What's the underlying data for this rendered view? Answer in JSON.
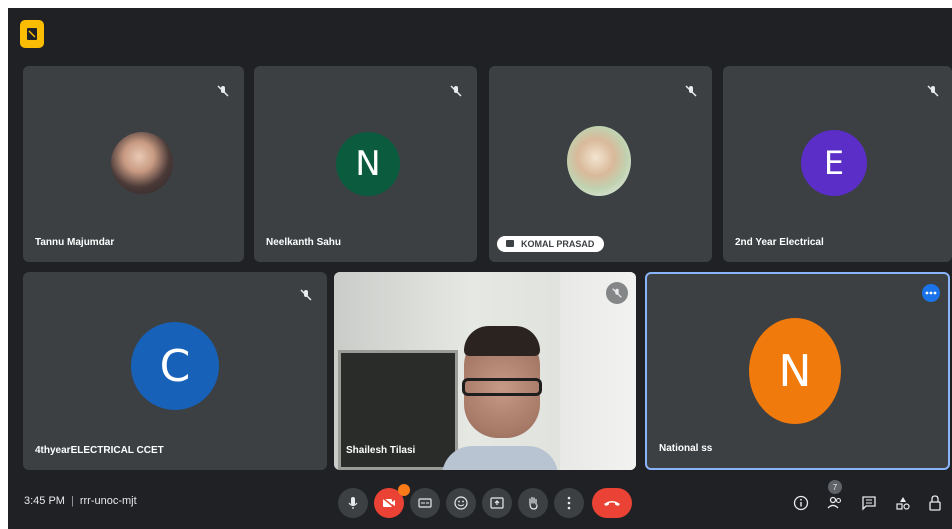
{
  "meeting": {
    "time": "3:45 PM",
    "separator": "|",
    "code": "rrr-unoc-mjt"
  },
  "participants": [
    {
      "name": "Tannu Majumdar",
      "avatar_type": "photo",
      "muted": true
    },
    {
      "name": "Neelkanth Sahu",
      "initial": "N",
      "avatar_color": "#0b5c3e",
      "muted": true
    },
    {
      "name": "KOMAL PRASAD",
      "avatar_type": "photo",
      "muted": true,
      "presenting_chip": true
    },
    {
      "name": "2nd Year Electrical",
      "initial": "E",
      "avatar_color": "#5b2ec7",
      "muted": true
    },
    {
      "name": "4thyearELECTRICAL CCET",
      "initial": "C",
      "avatar_color": "#1762b8",
      "muted": true
    },
    {
      "name": "Shailesh Tilasi",
      "avatar_type": "video",
      "muted": true
    },
    {
      "name": "National ss",
      "initial": "N",
      "avatar_color": "#f07a0c",
      "muted": false,
      "active_speaker": true
    }
  ],
  "people_count": "7",
  "colors": {
    "background": "#202124",
    "tile": "#3c4043",
    "end_call": "#ea4335",
    "active_border": "#8ab4f8",
    "badge": "#fbbc04"
  },
  "controls": [
    "microphone-icon",
    "camera-off-icon",
    "captions-icon",
    "emoji-icon",
    "present-icon",
    "raise-hand-icon",
    "more-options-icon",
    "end-call-icon"
  ],
  "right_controls": [
    "info-icon",
    "people-icon",
    "chat-icon",
    "activities-icon",
    "host-controls-icon"
  ]
}
